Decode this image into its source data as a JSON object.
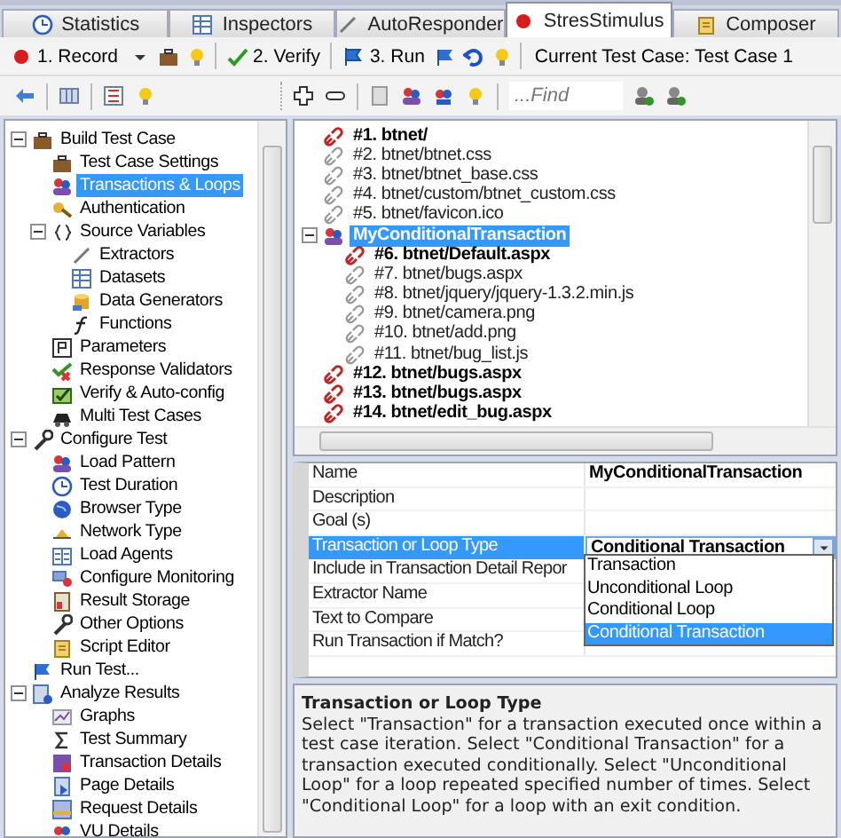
{
  "tabs": [
    {
      "label": "Statistics",
      "selected": false
    },
    {
      "label": "Inspectors",
      "selected": false
    },
    {
      "label": "AutoResponder",
      "selected": false
    },
    {
      "label": "StresStimulus",
      "selected": true
    },
    {
      "label": "Composer",
      "selected": false
    }
  ],
  "toolbar": {
    "record": "1. Record",
    "verify": "2. Verify",
    "run": "3. Run",
    "current_test_case": "Current Test Case: Test Case 1"
  },
  "find": {
    "placeholder": "...Find"
  },
  "nav_tree": [
    {
      "label": "Build Test Case",
      "selected": false,
      "expanded": true,
      "children": [
        {
          "label": "Test Case Settings",
          "selected": false
        },
        {
          "label": "Transactions & Loops",
          "selected": true
        },
        {
          "label": "Authentication",
          "selected": false
        },
        {
          "label": "Source Variables",
          "selected": false,
          "expanded": true,
          "children": [
            {
              "label": "Extractors",
              "selected": false
            },
            {
              "label": "Datasets",
              "selected": false
            },
            {
              "label": "Data Generators",
              "selected": false
            },
            {
              "label": "Functions",
              "selected": false
            }
          ]
        },
        {
          "label": "Parameters",
          "selected": false
        },
        {
          "label": "Response Validators",
          "selected": false
        },
        {
          "label": "Verify & Auto-config",
          "selected": false
        },
        {
          "label": "Multi Test Cases",
          "selected": false
        }
      ]
    },
    {
      "label": "Configure Test",
      "selected": false,
      "expanded": true,
      "children": [
        {
          "label": "Load Pattern",
          "selected": false
        },
        {
          "label": "Test Duration",
          "selected": false
        },
        {
          "label": "Browser Type",
          "selected": false
        },
        {
          "label": "Network Type",
          "selected": false
        },
        {
          "label": "Load Agents",
          "selected": false
        },
        {
          "label": "Configure Monitoring",
          "selected": false
        },
        {
          "label": "Result Storage",
          "selected": false
        },
        {
          "label": "Other Options",
          "selected": false
        },
        {
          "label": "Script Editor",
          "selected": false
        }
      ]
    },
    {
      "label": "Run Test...",
      "selected": false
    },
    {
      "label": "Analyze Results",
      "selected": false,
      "expanded": true,
      "children": [
        {
          "label": "Graphs",
          "selected": false
        },
        {
          "label": "Test Summary",
          "selected": false
        },
        {
          "label": "Transaction Details",
          "selected": false
        },
        {
          "label": "Page Details",
          "selected": false
        },
        {
          "label": "Request Details",
          "selected": false
        },
        {
          "label": "VU Details",
          "selected": false
        }
      ]
    }
  ],
  "requests": [
    {
      "kind": "page",
      "label": "#1. btnet/",
      "selected": false
    },
    {
      "kind": "resource",
      "label": "#2. btnet/btnet.css",
      "selected": false
    },
    {
      "kind": "resource",
      "label": "#3. btnet/btnet_base.css",
      "selected": false
    },
    {
      "kind": "resource",
      "label": "#4. btnet/custom/btnet_custom.css",
      "selected": false
    },
    {
      "kind": "resource",
      "label": "#5. btnet/favicon.ico",
      "selected": false
    },
    {
      "kind": "transaction",
      "label": "MyConditionalTransaction",
      "selected": true,
      "expanded": true,
      "children": [
        {
          "kind": "page",
          "label": "#6. btnet/Default.aspx",
          "selected": false
        },
        {
          "kind": "resource",
          "label": "#7. btnet/bugs.aspx",
          "selected": false
        },
        {
          "kind": "resource",
          "label": "#8. btnet/jquery/jquery-1.3.2.min.js",
          "selected": false
        },
        {
          "kind": "resource",
          "label": "#9. btnet/camera.png",
          "selected": false
        },
        {
          "kind": "resource",
          "label": "#10. btnet/add.png",
          "selected": false
        },
        {
          "kind": "resource",
          "label": "#11. btnet/bug_list.js",
          "selected": false
        }
      ]
    },
    {
      "kind": "page",
      "label": "#12. btnet/bugs.aspx",
      "selected": false
    },
    {
      "kind": "page",
      "label": "#13. btnet/bugs.aspx",
      "selected": false
    },
    {
      "kind": "page",
      "label": "#14. btnet/edit_bug.aspx",
      "selected": false
    }
  ],
  "properties": [
    {
      "name": "Name",
      "value": "MyConditionalTransaction",
      "selected": false
    },
    {
      "name": "Description",
      "selected": false
    },
    {
      "name": "Goal (s)",
      "selected": false
    },
    {
      "name": "Transaction or Loop Type",
      "value": "Conditional Transaction",
      "kind": "dropdown",
      "selected": true
    },
    {
      "name": "Include in Transaction Detail Repor",
      "selected": false
    },
    {
      "name": "Extractor Name",
      "selected": false
    },
    {
      "name": "Text to Compare",
      "selected": false
    },
    {
      "name": "Run Transaction if Match?",
      "selected": false
    }
  ],
  "dropdown": {
    "options": [
      {
        "label": "Transaction",
        "selected": false
      },
      {
        "label": "Unconditional Loop",
        "selected": false
      },
      {
        "label": "Conditional Loop",
        "selected": false
      },
      {
        "label": "Conditional Transaction",
        "selected": true
      }
    ]
  },
  "description": {
    "title": "Transaction or Loop Type",
    "text": "Select \"Transaction\" for a transaction executed once within a test case iteration. Select \"Conditional Transaction\" for a transaction executed conditionally. Select \"Unconditional Loop\" for a loop repeated specified number of times. Select \"Conditional Loop\" for a loop with an exit condition."
  }
}
